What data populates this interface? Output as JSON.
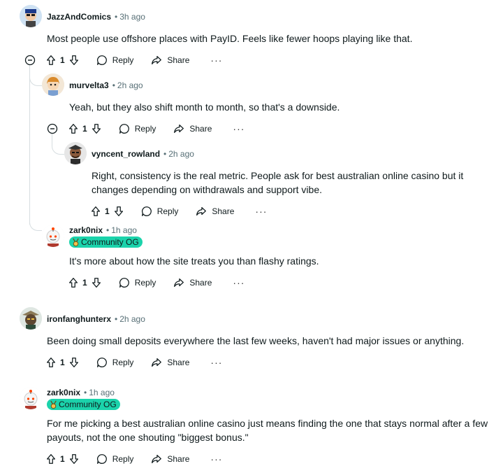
{
  "comments": [
    {
      "author": "JazzAndComics",
      "time": "3h ago",
      "body": "Most people use offshore places with PayID. Feels like fewer hoops playing like that.",
      "votes": "1",
      "reply": "Reply",
      "share": "Share",
      "more": "···"
    },
    {
      "author": "murvelta3",
      "time": "2h ago",
      "body": "Yeah, but they also shift month to month, so that's a downside.",
      "votes": "1",
      "reply": "Reply",
      "share": "Share",
      "more": "···"
    },
    {
      "author": "vyncent_rowland",
      "time": "2h ago",
      "body": "Right, consistency is the real metric. People ask for best australian online casino but it changes depending on withdrawals and support vibe.",
      "votes": "1",
      "reply": "Reply",
      "share": "Share",
      "more": "···"
    },
    {
      "author": "zark0nix",
      "time": "1h ago",
      "flair": "Community OG",
      "body": "It's more about how the site treats you than flashy ratings.",
      "votes": "1",
      "reply": "Reply",
      "share": "Share",
      "more": "···"
    },
    {
      "author": "ironfanghunterx",
      "time": "2h ago",
      "body": "Been doing small deposits everywhere the last few weeks, haven't had major issues or anything.",
      "votes": "1",
      "reply": "Reply",
      "share": "Share",
      "more": "···"
    },
    {
      "author": "zark0nix",
      "time": "1h ago",
      "flair": "Community OG",
      "body": "For me picking a best australian online casino just means finding the one that stays normal after a few payouts, not the one shouting \"biggest bonus.\"",
      "votes": "1",
      "reply": "Reply",
      "share": "Share",
      "more": "···"
    }
  ],
  "icons": {
    "upvote": "upvote-icon",
    "downvote": "downvote-icon",
    "reply": "reply-bubble-icon",
    "share": "share-arrow-icon",
    "collapse": "collapse-minus-icon",
    "flair_badge": "medal-icon"
  },
  "colors": {
    "flair_bg": "#1bd3ab",
    "meta_text": "#576f76",
    "thread_line": "#d6dde0"
  }
}
